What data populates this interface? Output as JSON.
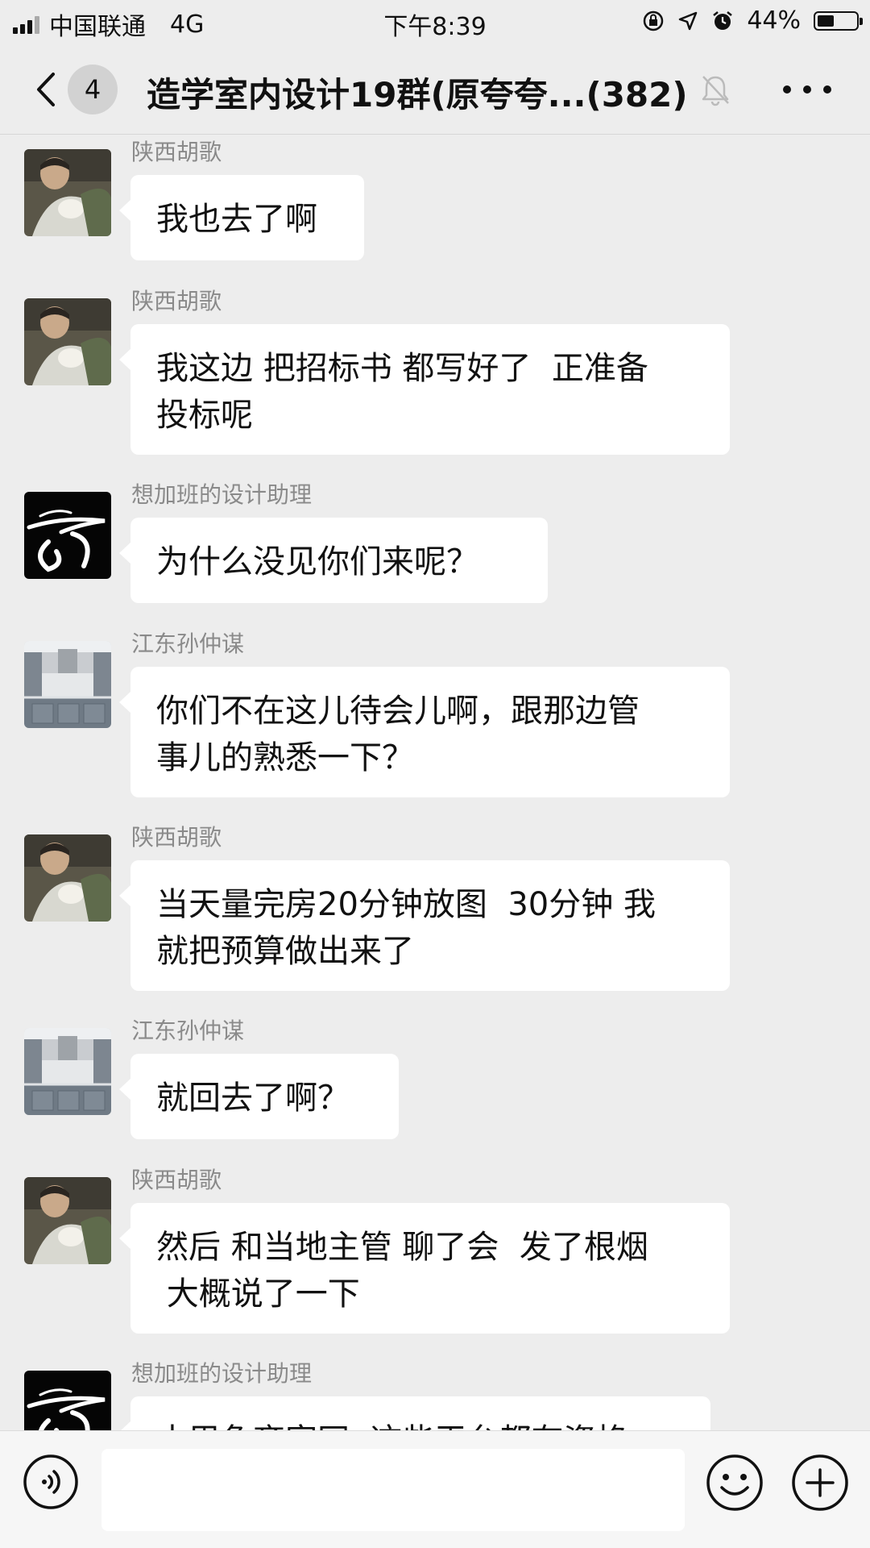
{
  "status_bar": {
    "carrier": "中国联通",
    "network": "4G",
    "time": "下午8:39",
    "battery_percent": "44%",
    "battery_level": 0.44,
    "icons": [
      "signal-icon",
      "orientation-lock-icon",
      "location-icon",
      "alarm-icon",
      "battery-icon"
    ]
  },
  "nav": {
    "unread_count": "4",
    "title": "造学室内设计19群(原夸夸...(382)",
    "icons": [
      "back-chevron-icon",
      "mute-bell-icon",
      "more-dots-icon"
    ]
  },
  "messages": [
    {
      "sender": "陕西胡歌",
      "avatar": "avatar-photo-man-cat",
      "text": "我也去了啊"
    },
    {
      "sender": "陕西胡歌",
      "avatar": "avatar-photo-man-cat",
      "text": "我这边 把招标书 都写好了  正准备\n投标呢"
    },
    {
      "sender": "想加班的设计助理",
      "avatar": "avatar-black-calligraphy",
      "text": "为什么没见你们来呢？"
    },
    {
      "sender": "江东孙仲谋",
      "avatar": "avatar-kitchen-photo",
      "text": "你们不在这儿待会儿啊，跟那边管\n事儿的熟悉一下？"
    },
    {
      "sender": "陕西胡歌",
      "avatar": "avatar-photo-man-cat",
      "text": "当天量完房20分钟放图  30分钟 我\n就把预算做出来了"
    },
    {
      "sender": "江东孙仲谋",
      "avatar": "avatar-kitchen-photo",
      "text": "就回去了啊？"
    },
    {
      "sender": "陕西胡歌",
      "avatar": "avatar-photo-man-cat",
      "text": "然后 和当地主管 聊了会  发了根烟\n 大概说了一下"
    },
    {
      "sender": "想加班的设计助理",
      "avatar": "avatar-black-calligraphy",
      "text": "土巴兔齐家网  这些平台都有资格"
    }
  ],
  "input": {
    "placeholder": "",
    "icons": [
      "voice-icon",
      "emoji-icon",
      "plus-icon"
    ]
  }
}
